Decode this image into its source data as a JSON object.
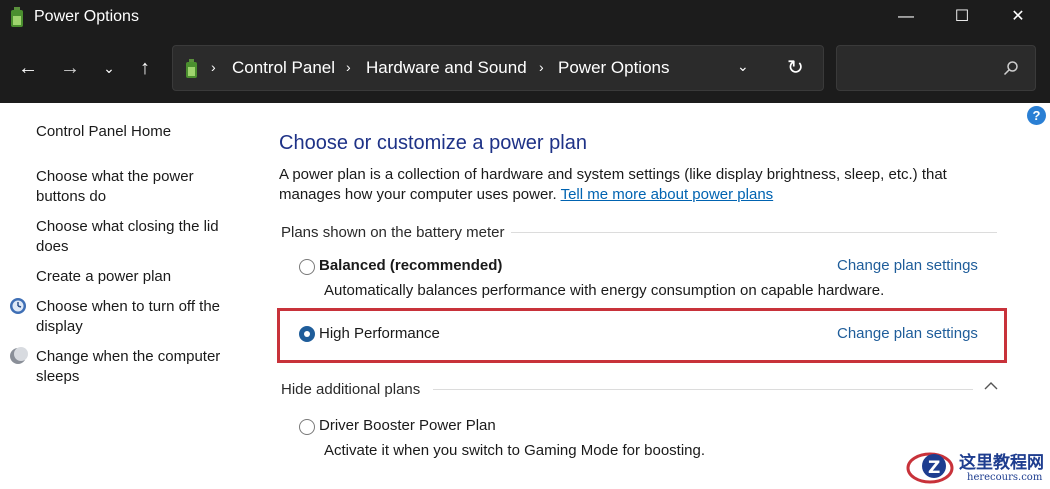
{
  "window": {
    "title": "Power Options",
    "min_glyph": "—",
    "max_glyph": "☐",
    "close_glyph": "✕"
  },
  "nav": {
    "back_glyph": "←",
    "forward_glyph": "→",
    "recent_glyph": "⌄",
    "up_glyph": "↑"
  },
  "address": {
    "crumbs": [
      "Control Panel",
      "Hardware and Sound",
      "Power Options"
    ],
    "separator": "›",
    "dropdown_glyph": "⌄",
    "refresh_glyph": "↻"
  },
  "search": {
    "placeholder": ""
  },
  "help": {
    "label": "?"
  },
  "sidebar": {
    "items": [
      {
        "label": "Control Panel Home"
      },
      {
        "label": "Choose what the power buttons do"
      },
      {
        "label": "Choose what closing the lid does"
      },
      {
        "label": "Create a power plan"
      },
      {
        "label": "Choose when to turn off the display",
        "icon": "display-icon"
      },
      {
        "label": "Change when the computer sleeps",
        "icon": "moon-icon"
      }
    ]
  },
  "main": {
    "title": "Choose or customize a power plan",
    "description": "A power plan is a collection of hardware and system settings (like display brightness, sleep, etc.) that manages how your computer uses power.",
    "learn_more_link": "Tell me more about power plans",
    "battery_section": "Plans shown on the battery meter",
    "additional_section": "Hide additional plans",
    "plans": [
      {
        "name": "Balanced (recommended)",
        "description": "Automatically balances performance with energy consumption on capable hardware.",
        "link": "Change plan settings",
        "selected": false
      },
      {
        "name": "High Performance",
        "description": "",
        "link": "Change plan settings",
        "selected": true
      },
      {
        "name": "Driver Booster Power Plan",
        "description": "Activate it when you switch to Gaming Mode for boosting.",
        "link": "",
        "selected": false
      }
    ]
  },
  "watermark": {
    "text": "这里教程网",
    "sub": "herecours.com"
  },
  "colors": {
    "titlebar": "#1c1c1c",
    "link": "#1f5d9a",
    "heading": "#1e3287",
    "highlight": "#c8323a"
  }
}
